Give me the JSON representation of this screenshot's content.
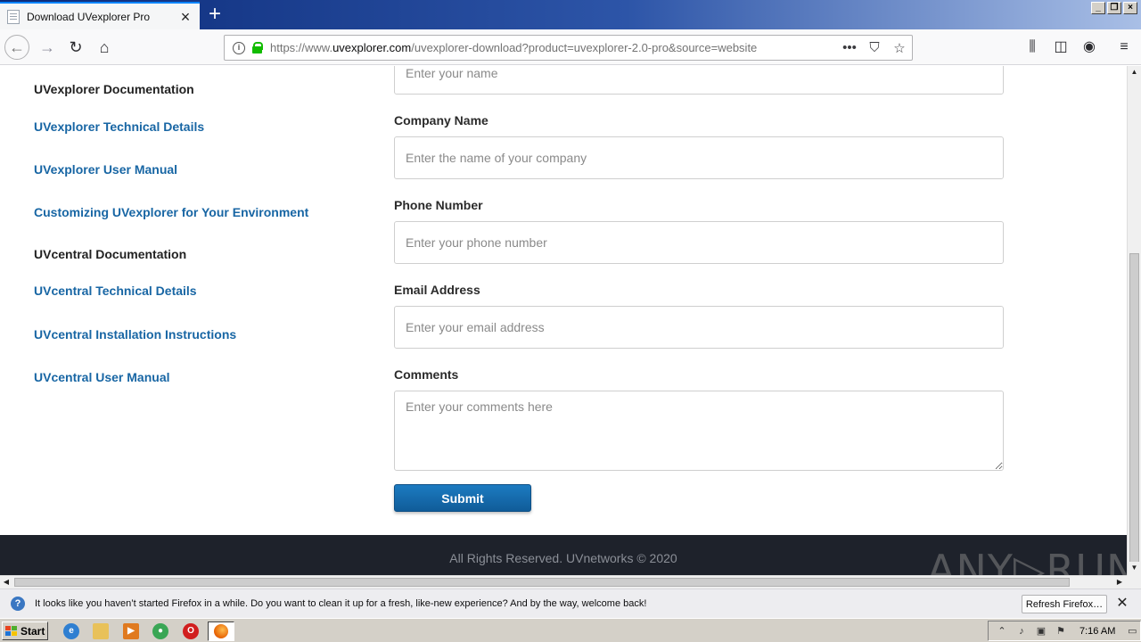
{
  "browser": {
    "tab_title": "Download UVexplorer Pro",
    "url_prefix": "https://www.",
    "url_domain": "uvexplorer.com",
    "url_path": "/uvexplorer-download?product=uvexplorer-2.0-pro&source=website",
    "page_actions_icon": "more-horizontal-icon",
    "accent": "#0a84ff",
    "secure_color": "#12bc00"
  },
  "sidebar": {
    "heading1": "UVexplorer Documentation",
    "links1": [
      "UVexplorer Technical Details",
      "UVexplorer User Manual",
      "Customizing UVexplorer for Your Environment"
    ],
    "heading2": "UVcentral Documentation",
    "links2": [
      "UVcentral Technical Details",
      "UVcentral Installation Instructions",
      "UVcentral User Manual"
    ],
    "link_color": "#1866a4"
  },
  "form": {
    "name_placeholder": "Enter your name",
    "company_label": "Company Name",
    "company_placeholder": "Enter the name of your company",
    "phone_label": "Phone Number",
    "phone_placeholder": "Enter your phone number",
    "email_label": "Email Address",
    "email_placeholder": "Enter your email address",
    "comments_label": "Comments",
    "comments_placeholder": "Enter your comments here",
    "submit_label": "Submit",
    "submit_color": "#1570b5"
  },
  "footer": {
    "copyright": "All Rights Reserved. UVnetworks © 2020"
  },
  "notification": {
    "message": "It looks like you haven’t started Firefox in a while. Do you want to clean it up for a fresh, like-new experience? And by the way, welcome back!",
    "refresh_label": "Refresh Firefox…"
  },
  "taskbar": {
    "start_label": "Start",
    "clock": "7:16 AM"
  },
  "watermark": "ANY▷RUN"
}
